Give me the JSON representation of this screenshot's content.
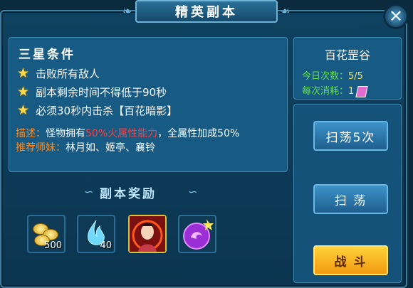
{
  "window": {
    "title": "精英副本",
    "close_symbol": "✕"
  },
  "conditions": {
    "header": "三星条件",
    "items": [
      "击败所有敌人",
      "副本剩余时间不得低于90秒",
      "必须30秒内击杀【百花暗影】"
    ]
  },
  "description": {
    "label": "描述：",
    "prefix": "怪物拥有",
    "highlight": "50%火属性能力",
    "suffix": "，全属性加成50%"
  },
  "recommend": {
    "label": "推荐师妹：",
    "names": "林月如、姬亭、襄铃"
  },
  "rewards": {
    "header": "副本奖励",
    "items": [
      {
        "icon": "gold-coins-icon",
        "count": "500"
      },
      {
        "icon": "blue-flame-icon",
        "count": "40"
      },
      {
        "icon": "heroine-portrait-icon",
        "count": ""
      },
      {
        "icon": "purple-orb-icon",
        "count": ""
      }
    ]
  },
  "dungeon": {
    "name": "百花罡谷",
    "daily_label": "今日次数：",
    "daily_value": "5/5",
    "cost_label": "每次消耗：",
    "cost_value": "1"
  },
  "buttons": {
    "sweep5": "扫荡5次",
    "sweep": "扫 荡",
    "battle": "战 斗"
  },
  "colors": {
    "accent_gold": "#ffd84a",
    "label_orange": "#ff8a1a",
    "highlight_red": "#ff3b3b",
    "stat_green": "#66e04a"
  }
}
